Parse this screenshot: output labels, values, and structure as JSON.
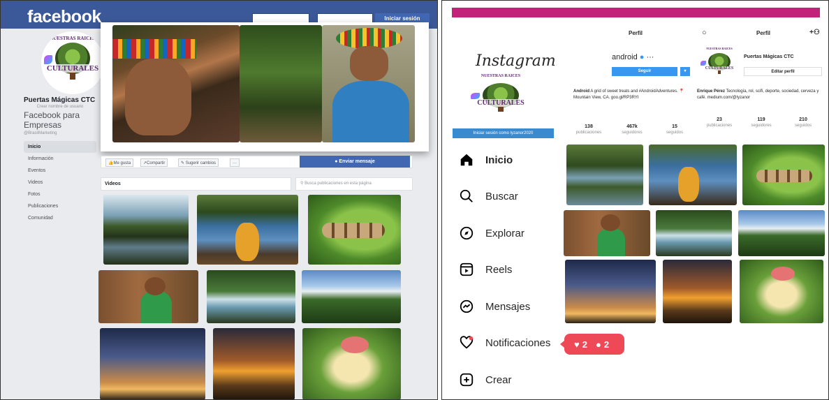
{
  "facebook": {
    "logo": "facebook",
    "login_button": "Iniciar sesión",
    "page_name": "Puertas Mágicas CTC",
    "page_subtitle": "Crear nombre de usuario",
    "category": "Facebook para Empresas",
    "handle": "@BrasilMarketing",
    "nav": [
      "Inicio",
      "Información",
      "Eventos",
      "Videos",
      "Fotos",
      "Publicaciones",
      "Comunidad"
    ],
    "actions": [
      "Me gusta",
      "Compartir",
      "Sugerir cambios",
      "···"
    ],
    "send_message": "Enviar mensaje",
    "videos_header": "Videos",
    "search_placeholder": "Busca publicaciones en esta página"
  },
  "logo_badge": {
    "arc_text": "NUESTRAS RAICES",
    "word": "CULTURALES"
  },
  "instagram": {
    "logo": "Instagram",
    "login_button": "Iniciar sesión como lyzanor2020",
    "tabs": [
      "Perfil",
      "Perfil"
    ],
    "profile_left": {
      "username": "android",
      "follow_button": "Seguir",
      "bio_name": "Android",
      "bio": "A grid of sweet treats and #AndroidAdventures. 📍 Mountain View, CA. goo.gl/RP3RYI",
      "stats": [
        {
          "value": "138",
          "label": "publicaciones"
        },
        {
          "value": "467k",
          "label": "seguidores"
        },
        {
          "value": "15",
          "label": "seguidos"
        }
      ]
    },
    "profile_right": {
      "name": "Puertas Mágicas CTC",
      "edit_button": "Editar perfil",
      "bio_name": "Enrique Pérez",
      "bio": "Tecnología, rol, scifi, deporte, sociedad, cerveza y café. medium.com/@lyzanor",
      "stats": [
        {
          "value": "23",
          "label": "publicaciones"
        },
        {
          "value": "119",
          "label": "seguidores"
        },
        {
          "value": "210",
          "label": "seguidos"
        }
      ]
    },
    "nav": [
      {
        "label": "Inicio",
        "icon": "home-icon"
      },
      {
        "label": "Buscar",
        "icon": "search-icon"
      },
      {
        "label": "Explorar",
        "icon": "compass-icon"
      },
      {
        "label": "Reels",
        "icon": "reels-icon"
      },
      {
        "label": "Mensajes",
        "icon": "messenger-icon"
      },
      {
        "label": "Notificaciones",
        "icon": "heart-icon"
      },
      {
        "label": "Crear",
        "icon": "plus-square-icon"
      }
    ],
    "notif_likes": "2",
    "notif_follows": "2"
  },
  "colors": {
    "fb_blue": "#3b5998",
    "fb_button": "#4267b2",
    "ig_notification": "#ed4956",
    "ig_topbar": "#c2227a"
  }
}
